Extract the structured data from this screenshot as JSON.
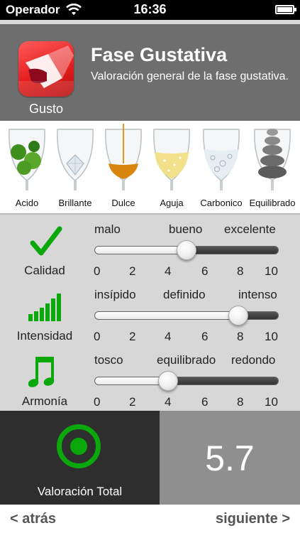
{
  "status_bar": {
    "carrier": "Operador",
    "time": "16:36"
  },
  "header": {
    "icon_label": "Gusto",
    "title": "Fase Gustativa",
    "subtitle": "Valoración general de la fase gustativa."
  },
  "glasses": [
    {
      "label": "Acido",
      "icon": "limes-glass-icon"
    },
    {
      "label": "Brillante",
      "icon": "diamond-glass-icon"
    },
    {
      "label": "Dulce",
      "icon": "honey-glass-icon"
    },
    {
      "label": "Aguja",
      "icon": "sparkling-glass-icon"
    },
    {
      "label": "Carbonico",
      "icon": "bubbles-glass-icon"
    },
    {
      "label": "Equilibrado",
      "icon": "stones-glass-icon"
    }
  ],
  "criteria": [
    {
      "label": "Calidad",
      "icon": "checkmark-icon",
      "scale_words": [
        "malo",
        "bueno",
        "excelente"
      ],
      "ticks": [
        "0",
        "2",
        "4",
        "6",
        "8",
        "10"
      ],
      "value": 5
    },
    {
      "label": "Intensidad",
      "icon": "signal-bars-icon",
      "scale_words": [
        "insípido",
        "definido",
        "intenso"
      ],
      "ticks": [
        "0",
        "2",
        "4",
        "6",
        "8",
        "10"
      ],
      "value": 7.8
    },
    {
      "label": "Armonía",
      "icon": "music-note-icon",
      "scale_words": [
        "tosco",
        "equilibrado",
        "redondo"
      ],
      "ticks": [
        "0",
        "2",
        "4",
        "6",
        "8",
        "10"
      ],
      "value": 4
    }
  ],
  "total": {
    "label": "Valoración Total",
    "score": "5.7"
  },
  "navigation": {
    "back": "< atrás",
    "next": "siguiente >"
  },
  "colors": {
    "accent_green": "#0aa80a",
    "header_gray": "#6e6e6e",
    "icon_red": "#e41e1e"
  }
}
